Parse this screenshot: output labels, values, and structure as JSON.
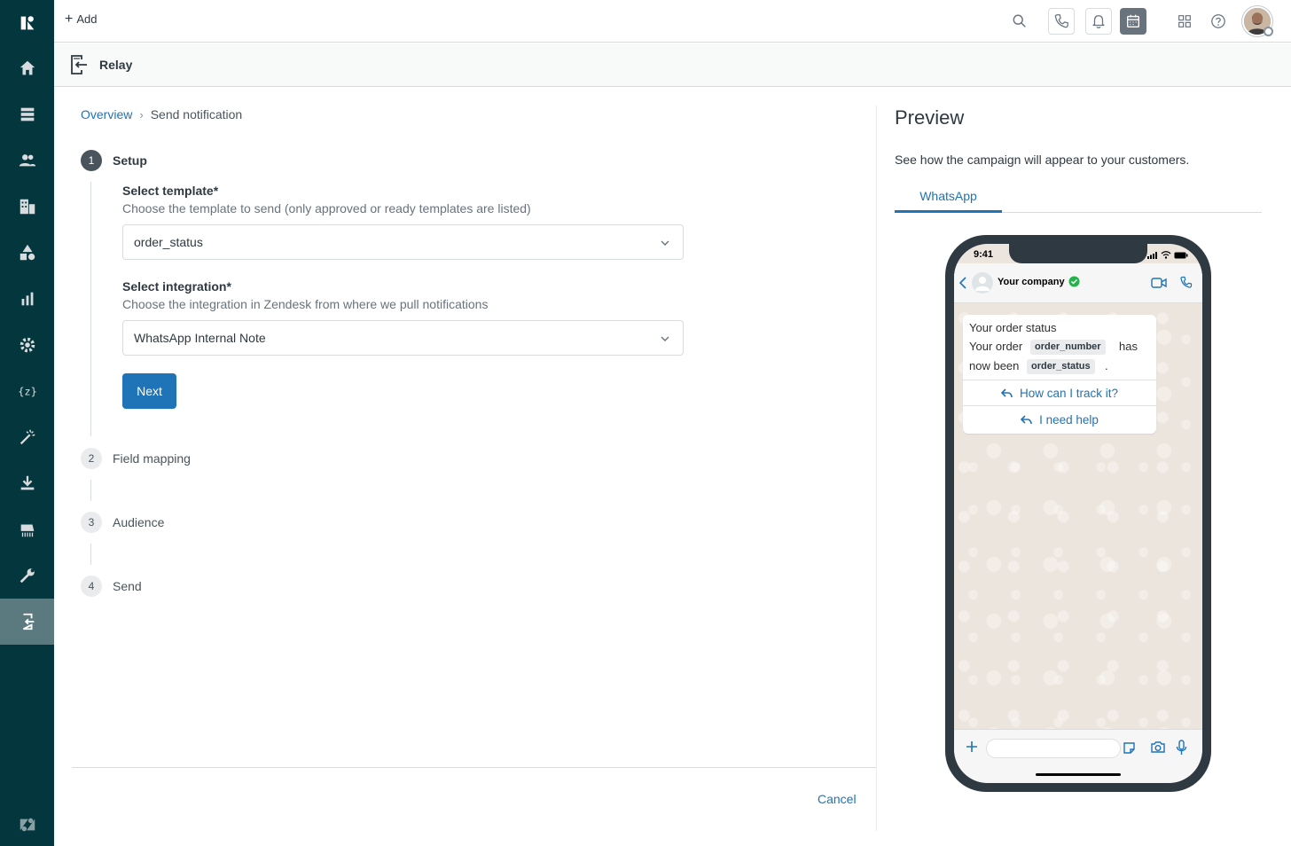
{
  "topbar": {
    "add_label": "Add"
  },
  "app": {
    "title": "Relay"
  },
  "breadcrumb": {
    "overview": "Overview",
    "separator": "›",
    "current": "Send notification"
  },
  "steps": [
    {
      "num": "1",
      "label": "Setup",
      "state": "active"
    },
    {
      "num": "2",
      "label": "Field mapping",
      "state": "inactive"
    },
    {
      "num": "3",
      "label": "Audience",
      "state": "inactive"
    },
    {
      "num": "4",
      "label": "Send",
      "state": "inactive"
    }
  ],
  "setup": {
    "template_label": "Select template*",
    "template_hint": "Choose the template to send (only approved or ready templates are listed)",
    "template_value": "order_status",
    "integration_label": "Select integration*",
    "integration_hint": "Choose the integration in Zendesk from where we pull notifications",
    "integration_value": "WhatsApp Internal Note",
    "next_label": "Next"
  },
  "footer": {
    "cancel_label": "Cancel"
  },
  "preview": {
    "title": "Preview",
    "description": "See how the campaign will appear to your customers.",
    "tab": "WhatsApp",
    "phone": {
      "time": "9:41",
      "contact": "Your company",
      "message_title": "Your order status",
      "line1_prefix": "Your order",
      "var1": "order_number",
      "line1_suffix": "has",
      "line2_prefix": "now been",
      "var2": "order_status",
      "line2_suffix": ".",
      "quick_reply_1": "How can I track it?",
      "quick_reply_2": "I need help"
    }
  },
  "colors": {
    "nav_bg": "#03363d",
    "nav_active": "#5a7a7f",
    "accent": "#1f73b7",
    "phone_frame": "#2f3941",
    "chat_bg": "#ece5dd",
    "verified": "#25b14b"
  },
  "icons": {
    "nav": [
      "zendesk-logo-icon",
      "home-icon",
      "views-icon",
      "customers-icon",
      "organizations-icon",
      "objects-icon",
      "reporting-icon",
      "admin-icon",
      "placeholder-icon",
      "magic-wand-icon",
      "download-icon",
      "printer-icon",
      "wrench-icon",
      "relay-app-icon",
      "zendesk-z-icon"
    ],
    "topbar": [
      "search-icon",
      "phone-icon",
      "bell-icon",
      "calendar-icon",
      "apps-grid-icon",
      "help-icon"
    ]
  }
}
